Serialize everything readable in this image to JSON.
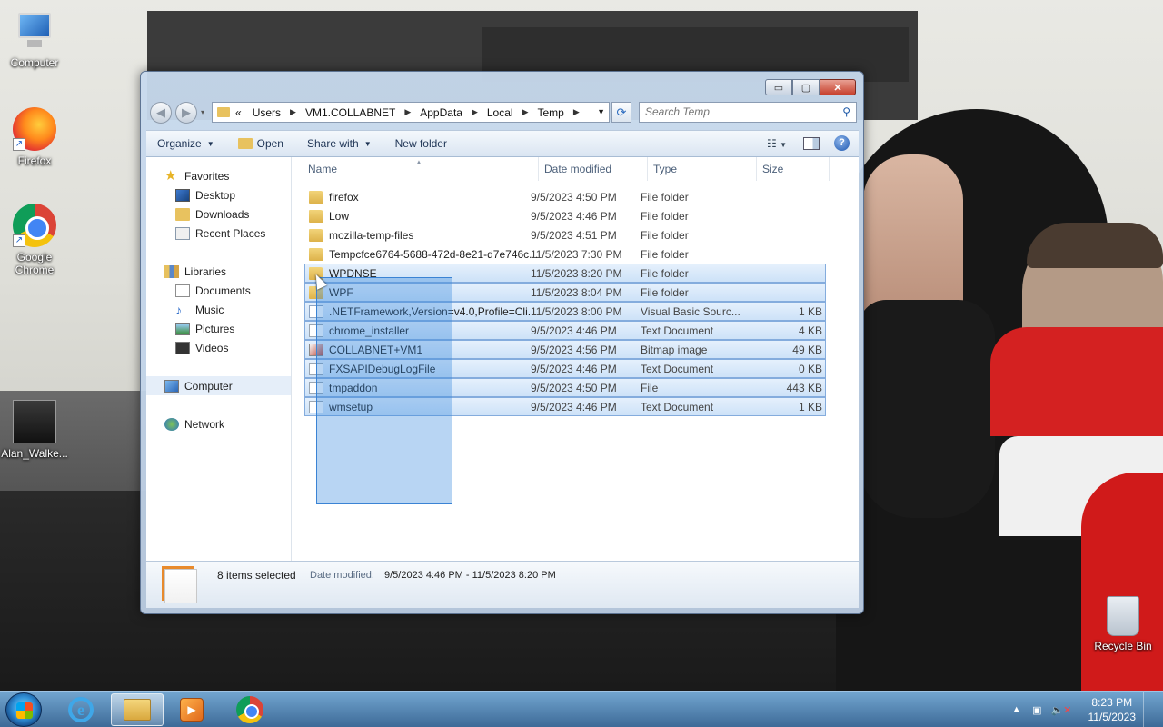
{
  "desktop": {
    "icons": [
      {
        "label": "Computer"
      },
      {
        "label": "Firefox"
      },
      {
        "label": "Google Chrome"
      },
      {
        "label": "Alan_Walke..."
      },
      {
        "label": "Recycle Bin"
      }
    ]
  },
  "window": {
    "controls": {
      "minimize": "▭",
      "maximize": "▢",
      "close": "✕"
    },
    "nav": {
      "back_icon": "back-arrow-icon",
      "forward_icon": "forward-arrow-icon",
      "overflow": "«",
      "breadcrumbs": [
        "Users",
        "VM1.COLLABNET",
        "AppData",
        "Local",
        "Temp"
      ],
      "search_placeholder": "Search Temp"
    },
    "toolbar": {
      "organize": "Organize",
      "open": "Open",
      "share_with": "Share with",
      "new_folder": "New folder"
    },
    "navpane": {
      "favorites": "Favorites",
      "desktop": "Desktop",
      "downloads": "Downloads",
      "recent_places": "Recent Places",
      "libraries": "Libraries",
      "documents": "Documents",
      "music": "Music",
      "pictures": "Pictures",
      "videos": "Videos",
      "computer": "Computer",
      "network": "Network"
    },
    "columns": {
      "name": "Name",
      "date": "Date modified",
      "type": "Type",
      "size": "Size"
    },
    "files": [
      {
        "name": "firefox",
        "date": "9/5/2023 4:50 PM",
        "type": "File folder",
        "size": "",
        "icon": "folder",
        "selected": false
      },
      {
        "name": "Low",
        "date": "9/5/2023 4:46 PM",
        "type": "File folder",
        "size": "",
        "icon": "folder",
        "selected": false
      },
      {
        "name": "mozilla-temp-files",
        "date": "9/5/2023 4:51 PM",
        "type": "File folder",
        "size": "",
        "icon": "folder",
        "selected": false
      },
      {
        "name": "Tempcfce6764-5688-472d-8e21-d7e746c...",
        "date": "11/5/2023 7:30 PM",
        "type": "File folder",
        "size": "",
        "icon": "folder",
        "selected": false
      },
      {
        "name": "WPDNSE",
        "date": "11/5/2023 8:20 PM",
        "type": "File folder",
        "size": "",
        "icon": "folder",
        "selected": true
      },
      {
        "name": "WPF",
        "date": "11/5/2023 8:04 PM",
        "type": "File folder",
        "size": "",
        "icon": "folder",
        "selected": true
      },
      {
        "name": ".NETFramework,Version=v4.0,Profile=Cli...",
        "date": "11/5/2023 8:00 PM",
        "type": "Visual Basic Sourc...",
        "size": "1 KB",
        "icon": "vbs",
        "selected": true
      },
      {
        "name": "chrome_installer",
        "date": "9/5/2023 4:46 PM",
        "type": "Text Document",
        "size": "4 KB",
        "icon": "file",
        "selected": true
      },
      {
        "name": "COLLABNET+VM1",
        "date": "9/5/2023 4:56 PM",
        "type": "Bitmap image",
        "size": "49 KB",
        "icon": "bmp",
        "selected": true
      },
      {
        "name": "FXSAPIDebugLogFile",
        "date": "9/5/2023 4:46 PM",
        "type": "Text Document",
        "size": "0 KB",
        "icon": "file",
        "selected": true
      },
      {
        "name": "tmpaddon",
        "date": "9/5/2023 4:50 PM",
        "type": "File",
        "size": "443 KB",
        "icon": "file",
        "selected": true
      },
      {
        "name": "wmsetup",
        "date": "9/5/2023 4:46 PM",
        "type": "Text Document",
        "size": "1 KB",
        "icon": "file",
        "selected": true
      }
    ],
    "details": {
      "count": "8 items selected",
      "date_label": "Date modified:",
      "date_value": "9/5/2023 4:46 PM - 11/5/2023 8:20 PM"
    }
  },
  "taskbar": {
    "time": "8:23 PM",
    "date": "11/5/2023"
  }
}
